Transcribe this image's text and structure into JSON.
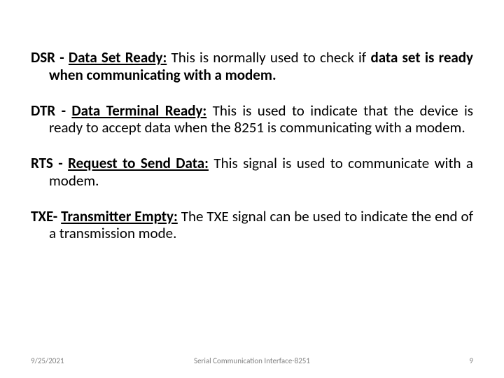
{
  "entries": [
    {
      "term_pre": "DSR - ",
      "term": "Data Set Ready:",
      "body_plain": " This is normally used to check if ",
      "body_bold": "data set is ready when communicating with a modem."
    },
    {
      "term_pre": "DTR - ",
      "term": "Data Terminal Ready:",
      "body_plain": " This is used to indicate that the device is ready to accept data when the 8251 is communicating with a modem.",
      "body_bold": ""
    },
    {
      "term_pre": "RTS - ",
      "term": "Request to Send Data:",
      "body_plain": " This signal is used to communicate with a modem.",
      "body_bold": ""
    },
    {
      "term_pre": "TXE- ",
      "term": "Transmitter Empty:",
      "body_plain": " The TXE signal can be used to indicate the end of a transmission mode.",
      "body_bold": ""
    }
  ],
  "footer": {
    "date": "9/25/2021",
    "title": "Serial Communication Interface-8251",
    "page": "9"
  }
}
